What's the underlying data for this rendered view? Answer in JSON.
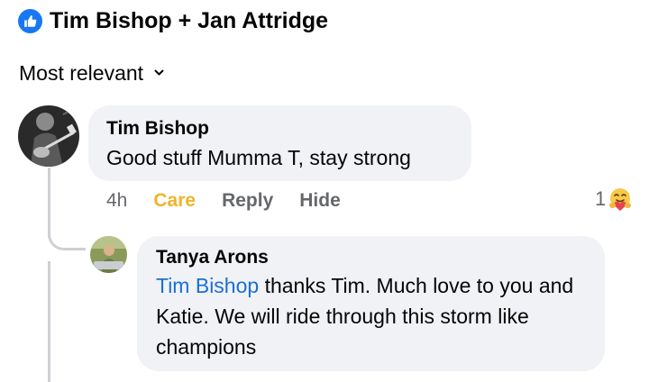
{
  "header": {
    "title": "Tim Bishop + Jan Attridge",
    "icon": "thumbs-up-icon",
    "icon_color": "#1877f2"
  },
  "sort": {
    "label": "Most relevant",
    "icon": "chevron-down-icon"
  },
  "comments": [
    {
      "author": "Tim Bishop",
      "text": "Good stuff Mumma T, stay strong",
      "time": "4h",
      "reaction_label": "Care",
      "reply_label": "Reply",
      "hide_label": "Hide",
      "reaction_count": "1",
      "reaction_icon": "care-emoji-icon",
      "reaction_color": "#f0b429"
    },
    {
      "author": "Tanya Arons",
      "mention": "Tim Bishop",
      "text": " thanks Tim.  Much love to you and Katie.  We will ride through this storm like champions",
      "mention_color": "#1b6fd6"
    }
  ]
}
